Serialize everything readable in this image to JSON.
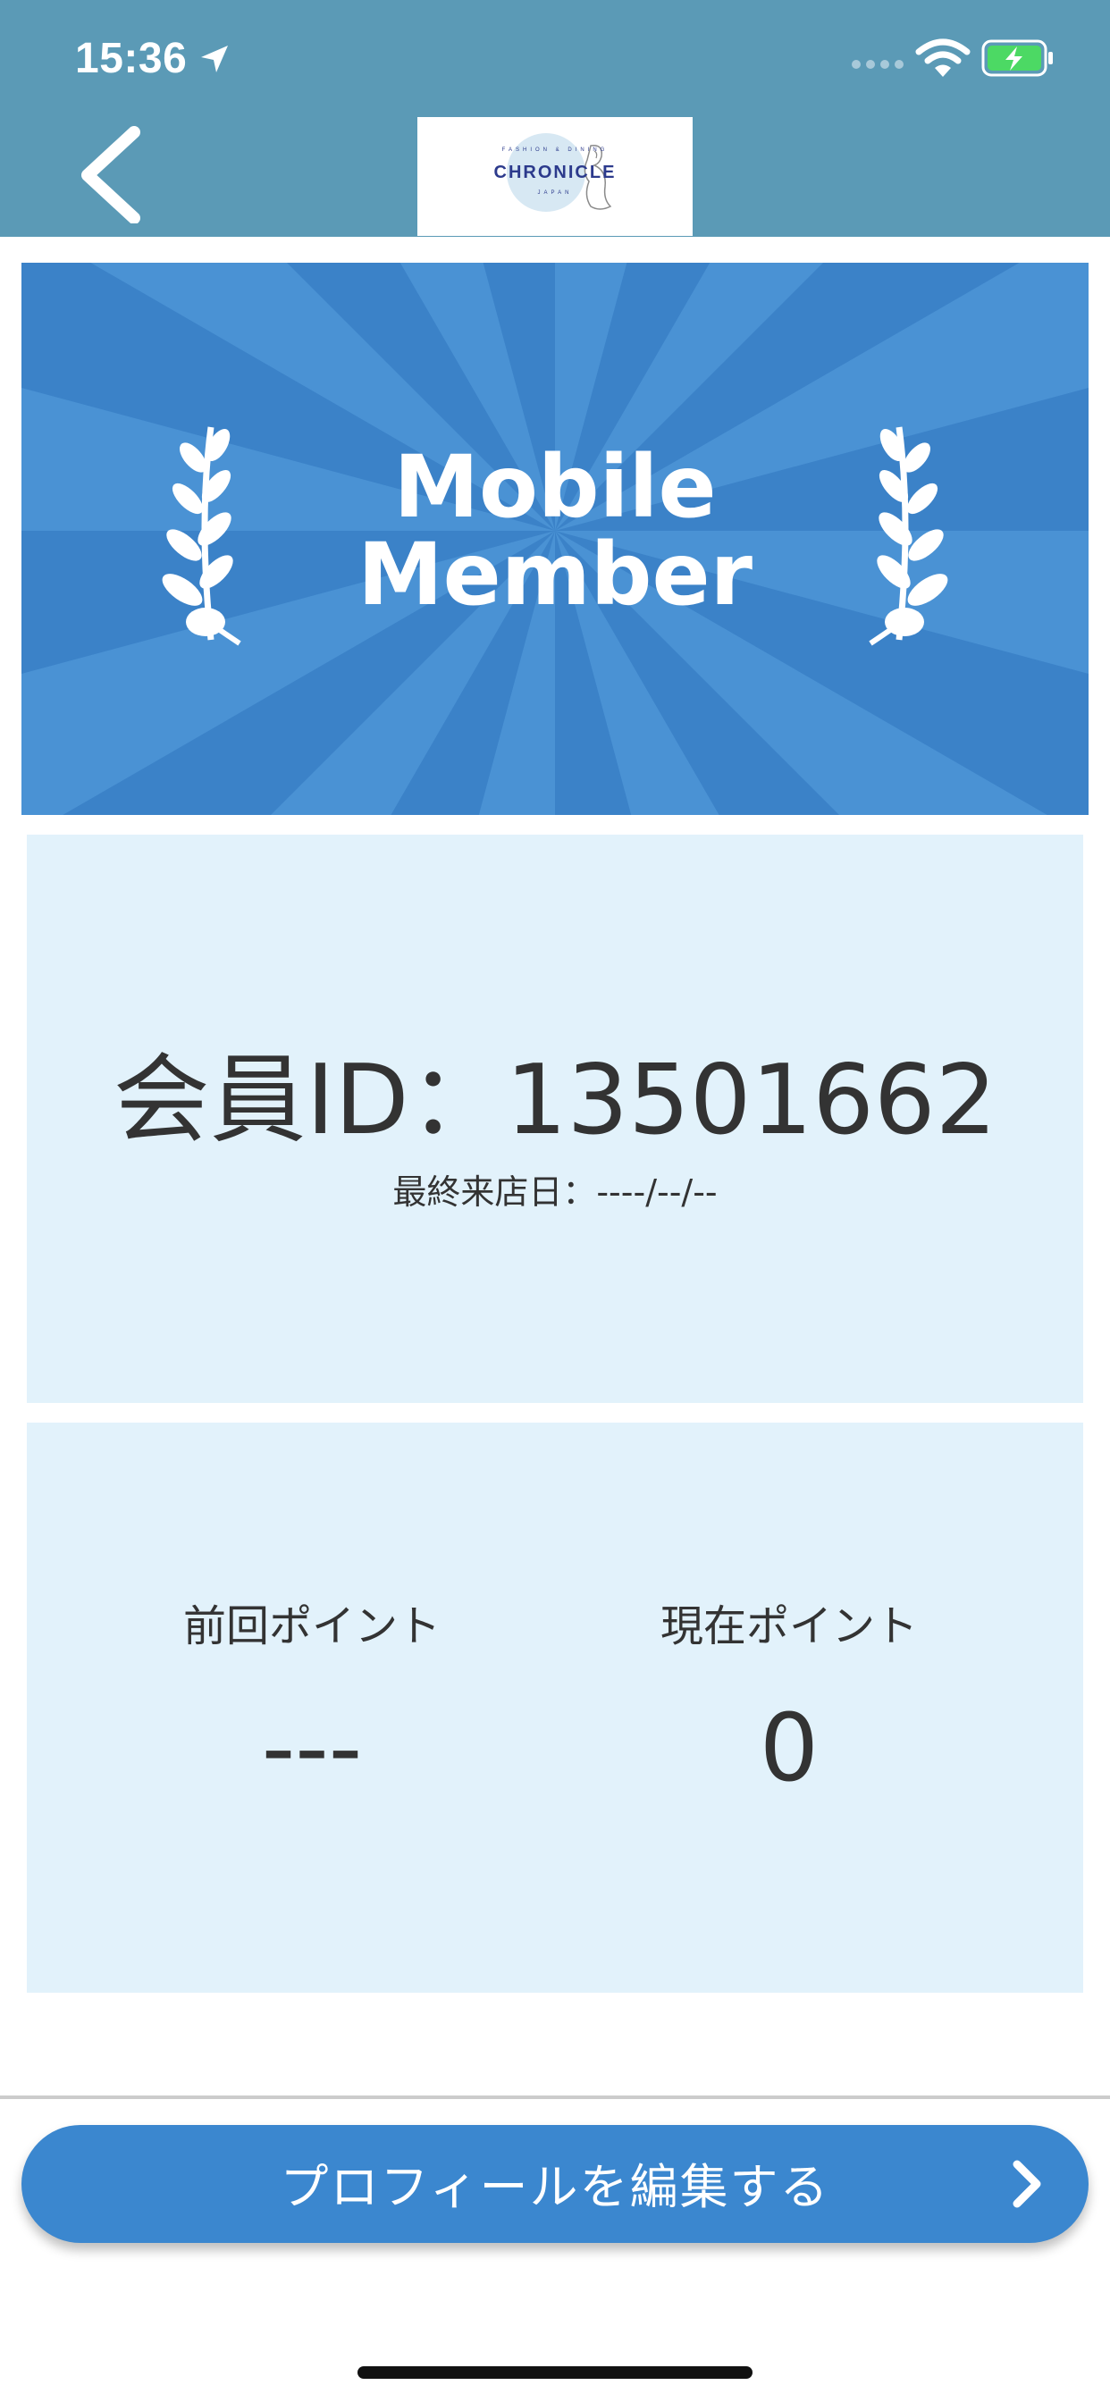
{
  "status_bar": {
    "time": "15:36"
  },
  "nav": {
    "logo": {
      "name": "CHRONICLE",
      "sub_top": "FASHION & DINING",
      "sub_bottom": "JAPAN"
    }
  },
  "banner": {
    "title_line1": "Mobile",
    "title_line2": "Member"
  },
  "member": {
    "id_text": "会員ID：13501662",
    "last_visit_text": "最終来店日：----/--/--"
  },
  "points": {
    "previous_label": "前回ポイント",
    "previous_value": "---",
    "current_label": "現在ポイント",
    "current_value": "0"
  },
  "actions": {
    "edit_profile_label": "プロフィールを編集する"
  },
  "colors": {
    "nav_bar": "#5b9ab6",
    "banner_blue": "#3b87cf",
    "card_bg": "#e2f2fb",
    "button_blue": "#3b87cf",
    "battery_green": "#4cd964"
  },
  "icons": {
    "back": "chevron-left-icon",
    "location": "location-arrow-icon",
    "wifi": "wifi-icon",
    "battery": "battery-charging-icon",
    "laurel": "laurel-branch-icon",
    "forward": "chevron-right-icon"
  }
}
